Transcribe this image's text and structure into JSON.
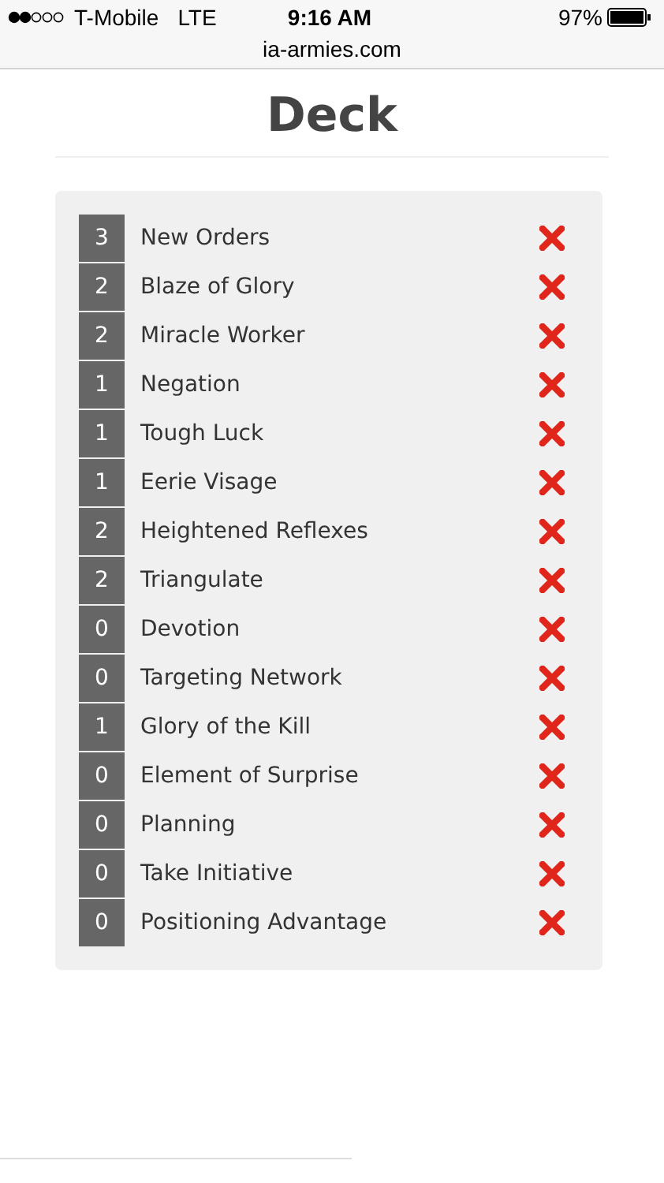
{
  "status_bar": {
    "carrier": "T-Mobile",
    "network": "LTE",
    "time": "9:16 AM",
    "battery": "97%"
  },
  "address_bar": {
    "url": "ia-armies.com"
  },
  "page": {
    "title": "Deck"
  },
  "cards": [
    {
      "count": "3",
      "name": "New Orders"
    },
    {
      "count": "2",
      "name": "Blaze of Glory"
    },
    {
      "count": "2",
      "name": "Miracle Worker"
    },
    {
      "count": "1",
      "name": "Negation"
    },
    {
      "count": "1",
      "name": "Tough Luck"
    },
    {
      "count": "1",
      "name": "Eerie Visage"
    },
    {
      "count": "2",
      "name": "Heightened Reflexes"
    },
    {
      "count": "2",
      "name": "Triangulate"
    },
    {
      "count": "0",
      "name": "Devotion"
    },
    {
      "count": "0",
      "name": "Targeting Network"
    },
    {
      "count": "1",
      "name": "Glory of the Kill"
    },
    {
      "count": "0",
      "name": "Element of Surprise"
    },
    {
      "count": "0",
      "name": "Planning"
    },
    {
      "count": "0",
      "name": "Take Initiative"
    },
    {
      "count": "0",
      "name": "Positioning Advantage"
    }
  ]
}
